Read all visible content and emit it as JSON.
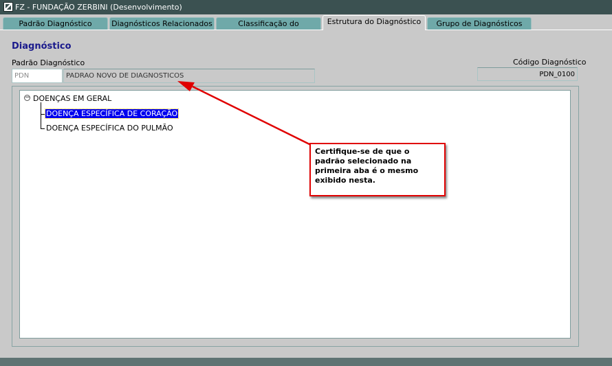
{
  "window": {
    "title": "FZ - FUNDAÇÃO ZERBINI (Desenvolvimento)"
  },
  "tabs": [
    {
      "label": "Padrão Diagnóstico"
    },
    {
      "label": "Diagnósticos Relacionados"
    },
    {
      "label": "Classificação do Diagnóstico"
    },
    {
      "label": "Estrutura do Diagnóstico",
      "active": true
    },
    {
      "label": "Grupo de Diagnósticos"
    }
  ],
  "section": {
    "heading": "Diagnóstico"
  },
  "form": {
    "padrao_label": "Padrão Diagnóstico",
    "padrao_code_placeholder": "PDN",
    "padrao_description": "PADRAO NOVO DE DIAGNOSTICOS",
    "codigo_label": "Código Diagnóstico",
    "codigo_value": "PDN_0100"
  },
  "tree": {
    "root": {
      "label": "DOENÇAS EM GERAL",
      "toggle": "−"
    },
    "children": [
      {
        "label": "DOENÇA ESPECÍFICA DE CORAÇÃO",
        "selected": true
      },
      {
        "label": "DOENÇA ESPECÍFICA DO PULMÃO",
        "selected": false
      }
    ]
  },
  "callout": {
    "text": "Certifique-se de que o padrão selecionado na primeira aba é o mesmo exibido nesta."
  },
  "colors": {
    "accent": "#e00000",
    "selection": "#0000ee",
    "titlebar": "#3b5151",
    "tab": "#6fa9a9"
  }
}
